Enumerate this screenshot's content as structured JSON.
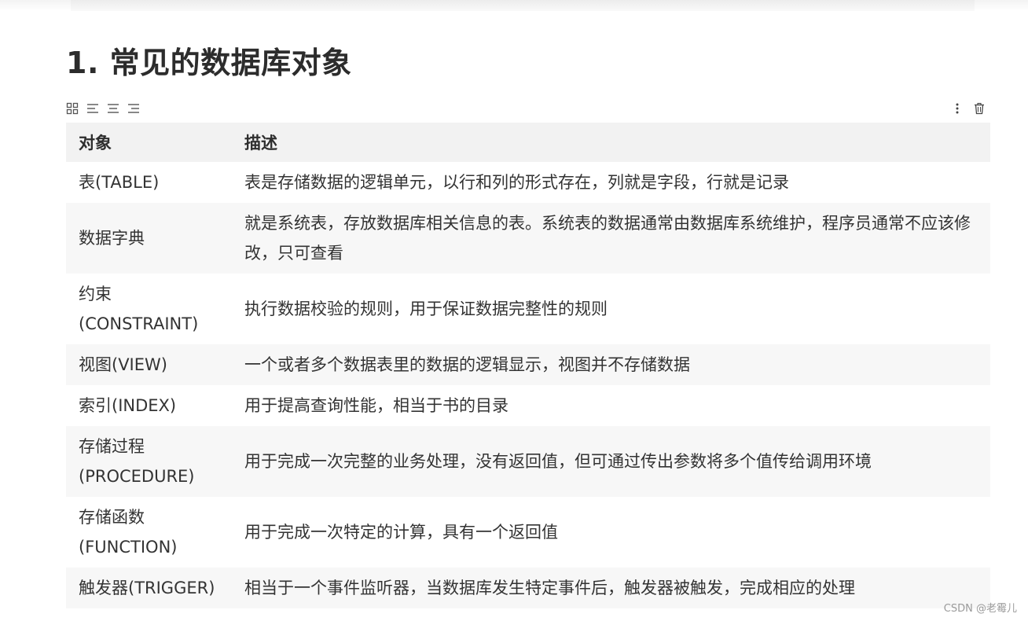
{
  "heading": "1. 常见的数据库对象",
  "toolbar": {
    "left_icons": [
      "table-grid-icon",
      "align-left-icon",
      "align-center-icon",
      "align-right-icon"
    ],
    "right_icons": [
      "more-vertical-icon",
      "trash-icon"
    ]
  },
  "table": {
    "headers": [
      "对象",
      "描述"
    ],
    "rows": [
      {
        "name": [
          "表(TABLE)"
        ],
        "desc": "表是存储数据的逻辑单元，以行和列的形式存在，列就是字段，行就是记录"
      },
      {
        "name": [
          "数据字典"
        ],
        "desc": "就是系统表，存放数据库相关信息的表。系统表的数据通常由数据库系统维护，程序员通常不应该修改，只可查看"
      },
      {
        "name": [
          "约束",
          "(CONSTRAINT)"
        ],
        "desc": "执行数据校验的规则，用于保证数据完整性的规则"
      },
      {
        "name": [
          "视图(VIEW)"
        ],
        "desc": "一个或者多个数据表里的数据的逻辑显示，视图并不存储数据"
      },
      {
        "name": [
          "索引(INDEX)"
        ],
        "desc": "用于提高查询性能，相当于书的目录"
      },
      {
        "name": [
          "存储过程",
          "(PROCEDURE)"
        ],
        "desc": "用于完成一次完整的业务处理，没有返回值，但可通过传出参数将多个值传给调用环境"
      },
      {
        "name": [
          "存储函数",
          "(FUNCTION)"
        ],
        "desc": "用于完成一次特定的计算，具有一个返回值"
      },
      {
        "name": [
          "触发器(TRIGGER)"
        ],
        "desc": "相当于一个事件监听器，当数据库发生特定事件后，触发器被触发，完成相应的处理"
      }
    ]
  },
  "watermark": "CSDN @老霉儿"
}
